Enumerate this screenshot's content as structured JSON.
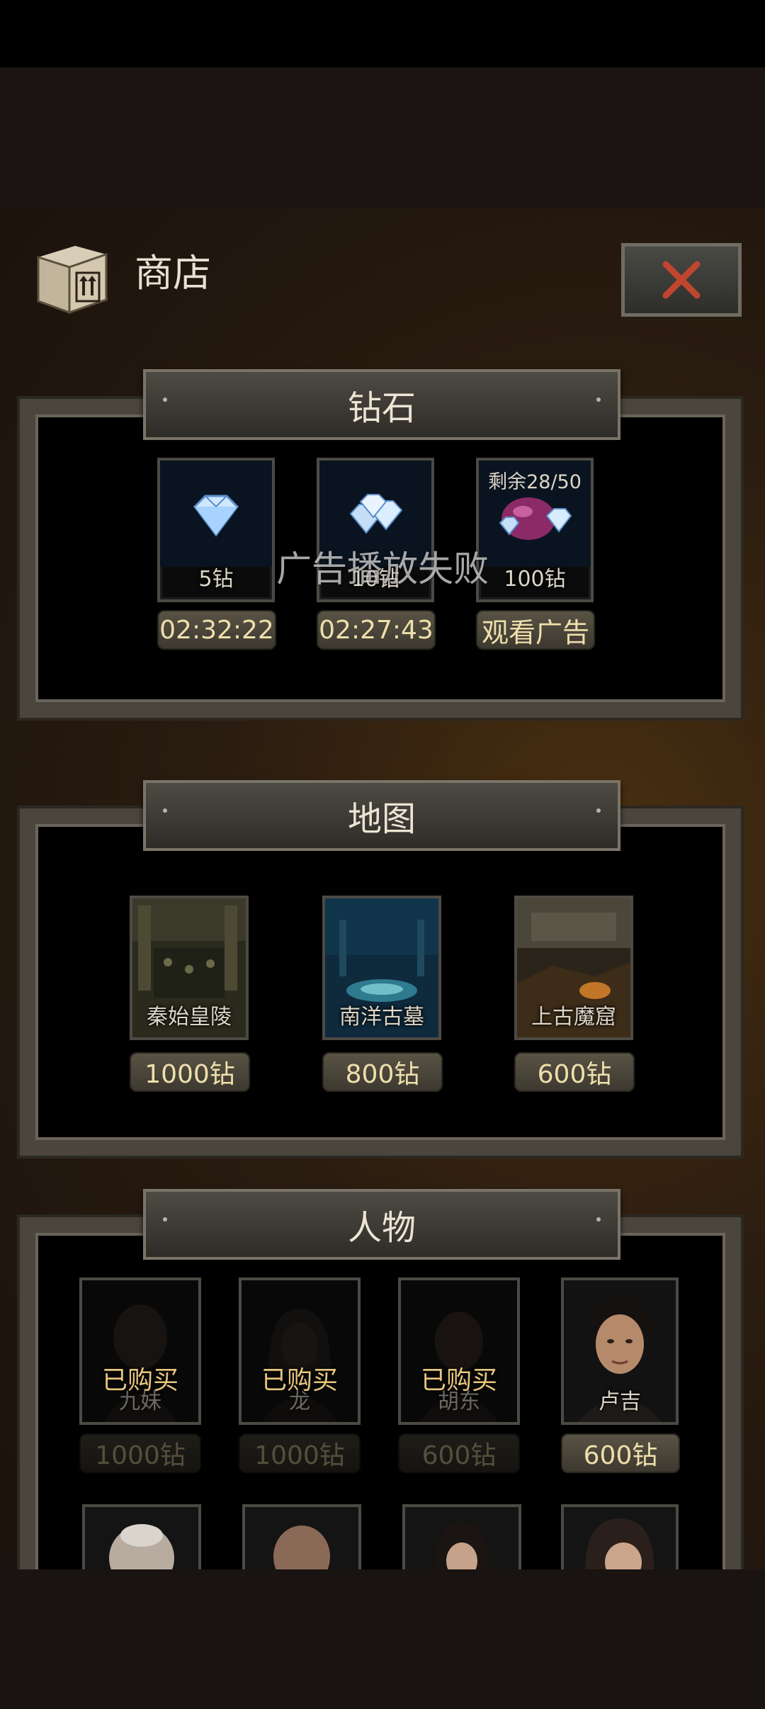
{
  "header": {
    "title": "商店"
  },
  "sections": {
    "diamonds": {
      "title": "钻石",
      "items": [
        {
          "label": "5钻",
          "button": "02:32:22",
          "icon": "diamond-icon"
        },
        {
          "label": "10钻",
          "button": "02:27:43",
          "icon": "diamond-pile-icon"
        },
        {
          "label": "100钻",
          "button": "观看广告",
          "remaining": "剩余28/50",
          "icon": "diamond-bag-icon"
        }
      ]
    },
    "maps": {
      "title": "地图",
      "items": [
        {
          "label": "秦始皇陵",
          "price": "1000钻"
        },
        {
          "label": "南洋古墓",
          "price": "800钻"
        },
        {
          "label": "上古魔窟",
          "price": "600钻"
        }
      ]
    },
    "characters": {
      "title": "人物",
      "items": [
        {
          "label": "九妹",
          "price": "1000钻",
          "status": "已购买"
        },
        {
          "label": "龙",
          "price": "1000钻",
          "status": "已购买"
        },
        {
          "label": "胡东",
          "price": "600钻",
          "status": "已购买"
        },
        {
          "label": "卢吉",
          "price": "600钻",
          "status": ""
        }
      ]
    }
  },
  "toast": "广告播放失败",
  "colors": {
    "accent": "#efdfac",
    "close": "#c0452f",
    "owned": "#e7c67e"
  }
}
